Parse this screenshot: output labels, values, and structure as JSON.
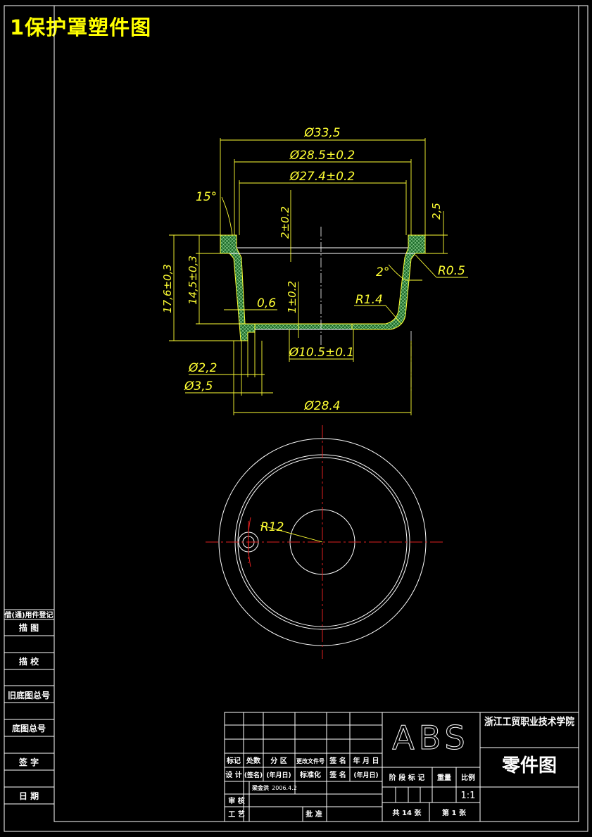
{
  "title": "1保护罩塑件图",
  "colors": {
    "background": "#000000",
    "frame": "#ffffff",
    "dimension": "#ffff33",
    "section_fill": "#2f8a3a",
    "centerline": "#e02020"
  },
  "dimensions": {
    "d_outer_flange": "Ø33,5",
    "d_inner_top": "Ø28.5±0.2",
    "d_inner_bottom": "Ø27.4±0.2",
    "angle_15": "15°",
    "h_2": "2±0.2",
    "h_2_5": "2,5",
    "r_0_5": "R0.5",
    "angle_2": "2°",
    "r_1_4": "R1.4",
    "h_17_6": "17,6±0,3",
    "h_14_5": "14,5±0,3",
    "t_0_6": "0,6",
    "t_1": "1±0.2",
    "d_10_5": "Ø10.5±0.1",
    "d_2_2": "Ø2,2",
    "d_3_5": "Ø3,5",
    "d_28_4": "Ø28.4",
    "r_12": "R12"
  },
  "left_column": {
    "items": [
      "借(通)用件登记",
      "描    图",
      "描    校",
      "旧底图总号",
      "底图总号",
      "签    字",
      "日    期"
    ]
  },
  "title_block": {
    "material": "ABS",
    "school": "浙江工贸职业技术学院",
    "drawing_name": "零件图",
    "row_headers": [
      "标记",
      "处数",
      "分 区",
      "更改文件号",
      "签 名",
      "年 月 日"
    ],
    "design": "设 计",
    "signature_label": "(签名)",
    "date_label": "(年月日)",
    "standardize": "标准化",
    "sign": "签 名",
    "date_label2": "(年月日)",
    "designer": "梁金洪",
    "design_date": "2006.4.2",
    "review": "审 核",
    "process": "工 艺",
    "approve": "批 准",
    "stage_mark": "阶 段 标 记",
    "weight": "重量",
    "scale": "比例",
    "scale_value": "1:1",
    "sheets_total": "共 14 张",
    "sheet_no": "第 1 张"
  }
}
